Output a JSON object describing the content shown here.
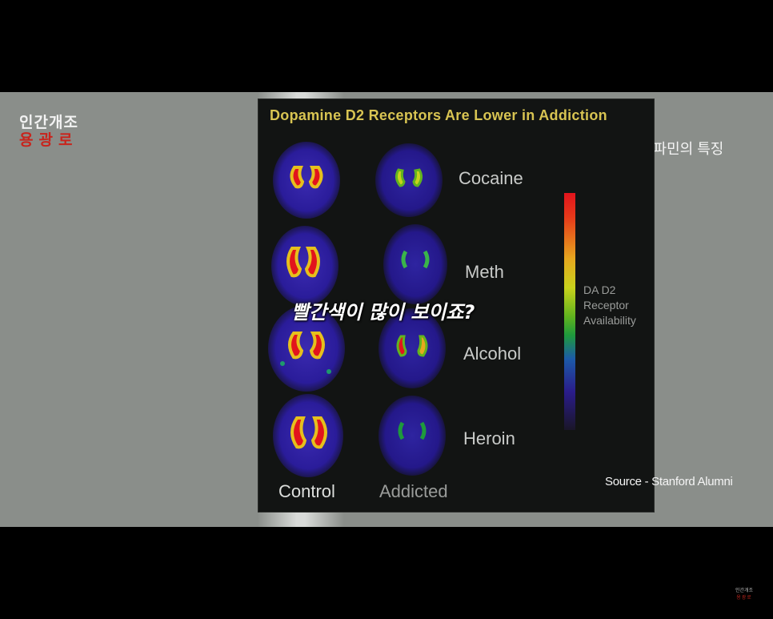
{
  "logo": {
    "line1": "인간개조",
    "line2": "용광로"
  },
  "corner_logo": {
    "line1": "인간개조",
    "line2": "용광로"
  },
  "panel": {
    "title": "Dopamine D2 Receptors Are Lower in Addiction",
    "rows": [
      "Cocaine",
      "Meth",
      "Alcohol",
      "Heroin"
    ],
    "columns": [
      "Control",
      "Addicted"
    ],
    "scale_label": [
      "DA D2",
      "Receptor",
      "Availability"
    ]
  },
  "captions": {
    "topic": "도파민의 특징",
    "source": "Source - Stanford Alumni",
    "subtitle": "빨간색이 많이 보이죠?"
  },
  "colors": {
    "title": "#d8c452",
    "logo_red": "#c8241c",
    "scan_bg": "#2a1c8a",
    "scan_hot": "#e2141c"
  }
}
